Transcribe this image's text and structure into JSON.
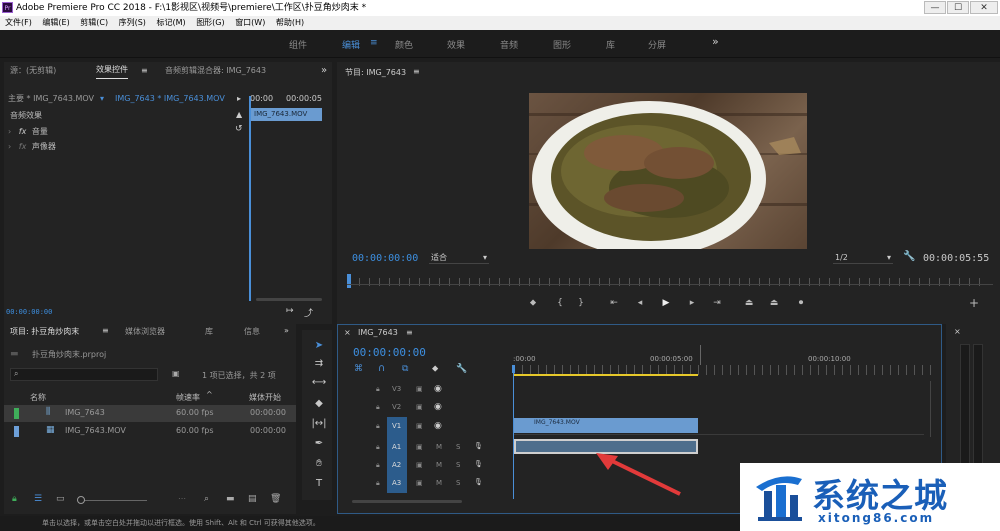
{
  "window": {
    "title": "Adobe Premiere Pro CC 2018 - F:\\1影视区\\视频号\\premiere\\工作区\\扑豆角炒肉末 *",
    "app_icon": "Pr",
    "minimize": "—",
    "maximize": "☐",
    "close": "✕"
  },
  "menu": [
    "文件(F)",
    "编辑(E)",
    "剪辑(C)",
    "序列(S)",
    "标记(M)",
    "图形(G)",
    "窗口(W)",
    "帮助(H)"
  ],
  "workspaces": {
    "items": [
      "组件",
      "编辑",
      "颜色",
      "效果",
      "音频",
      "图形",
      "库",
      "分屏"
    ],
    "active": "编辑",
    "more": "»"
  },
  "effect_controls": {
    "tabs": [
      "源：(无剪辑)",
      "效果控件",
      "音频剪辑混合器: IMG_7643"
    ],
    "master": "主要 * IMG_7643.MOV",
    "sequence_clip": "IMG_7643 * IMG_7643.MOV",
    "ruler_start": "00:00",
    "ruler_end": "00:00:05",
    "clip_label": "IMG_7643.MOV",
    "section": "音频效果",
    "fx_items": [
      "音量",
      "声像器"
    ],
    "timecode": "00:00:00:00"
  },
  "program_monitor": {
    "title": "节目: IMG_7643",
    "timecode": "00:00:00:00",
    "fit": "适合",
    "resolution": "1/2",
    "duration": "00:00:05:55"
  },
  "project": {
    "tabs": [
      "项目: 扑豆角炒肉末",
      "媒体浏览器",
      "库",
      "信息"
    ],
    "file": "扑豆角炒肉末.prproj",
    "selection_info": "1 项已选择，共 2 项",
    "columns": [
      "名称",
      "帧速率",
      "媒体开始"
    ],
    "rows": [
      {
        "name": "IMG_7643",
        "fps": "60.00 fps",
        "start": "00:00:00",
        "color": "#3fae5a"
      },
      {
        "name": "IMG_7643.MOV",
        "fps": "60.00 fps",
        "start": "00:00:00",
        "color": "#6d9fd8"
      }
    ]
  },
  "timeline": {
    "tab": "IMG_7643",
    "timecode": "00:00:00:00",
    "ruler": [
      ":00:00",
      "00:00:05:00",
      "00:00:10:00"
    ],
    "video_tracks": [
      "V3",
      "V2",
      "V1"
    ],
    "audio_tracks": [
      "A1",
      "A2",
      "A3"
    ],
    "video_clip": "IMG_7643.MOV",
    "track_buttons": {
      "mute": "M",
      "solo": "S"
    }
  },
  "statusbar": "单击以选择，或单击空白处并拖动以进行框选。使用 Shift、Alt 和 Ctrl 可获得其他选项。",
  "watermark": {
    "brand": "系统之城",
    "url": "xitong86.com"
  },
  "colors": {
    "accent": "#4a8fd8",
    "clip_video": "#6a9bd0",
    "clip_audio": "#4e6e8c",
    "playhead": "#4a8fd8"
  }
}
